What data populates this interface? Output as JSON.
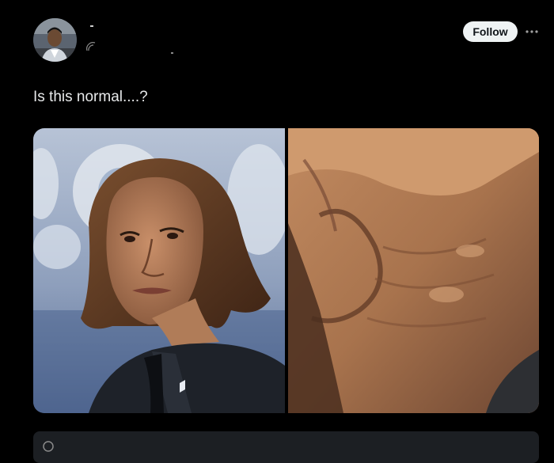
{
  "post": {
    "author_name": "",
    "author_handle": "",
    "follow_label": "Follow",
    "more_icon": "more-horizontal-icon",
    "text": "Is this normal....?",
    "media": {
      "left_image_alt": "",
      "right_image_alt": ""
    },
    "reply_hint": ""
  }
}
